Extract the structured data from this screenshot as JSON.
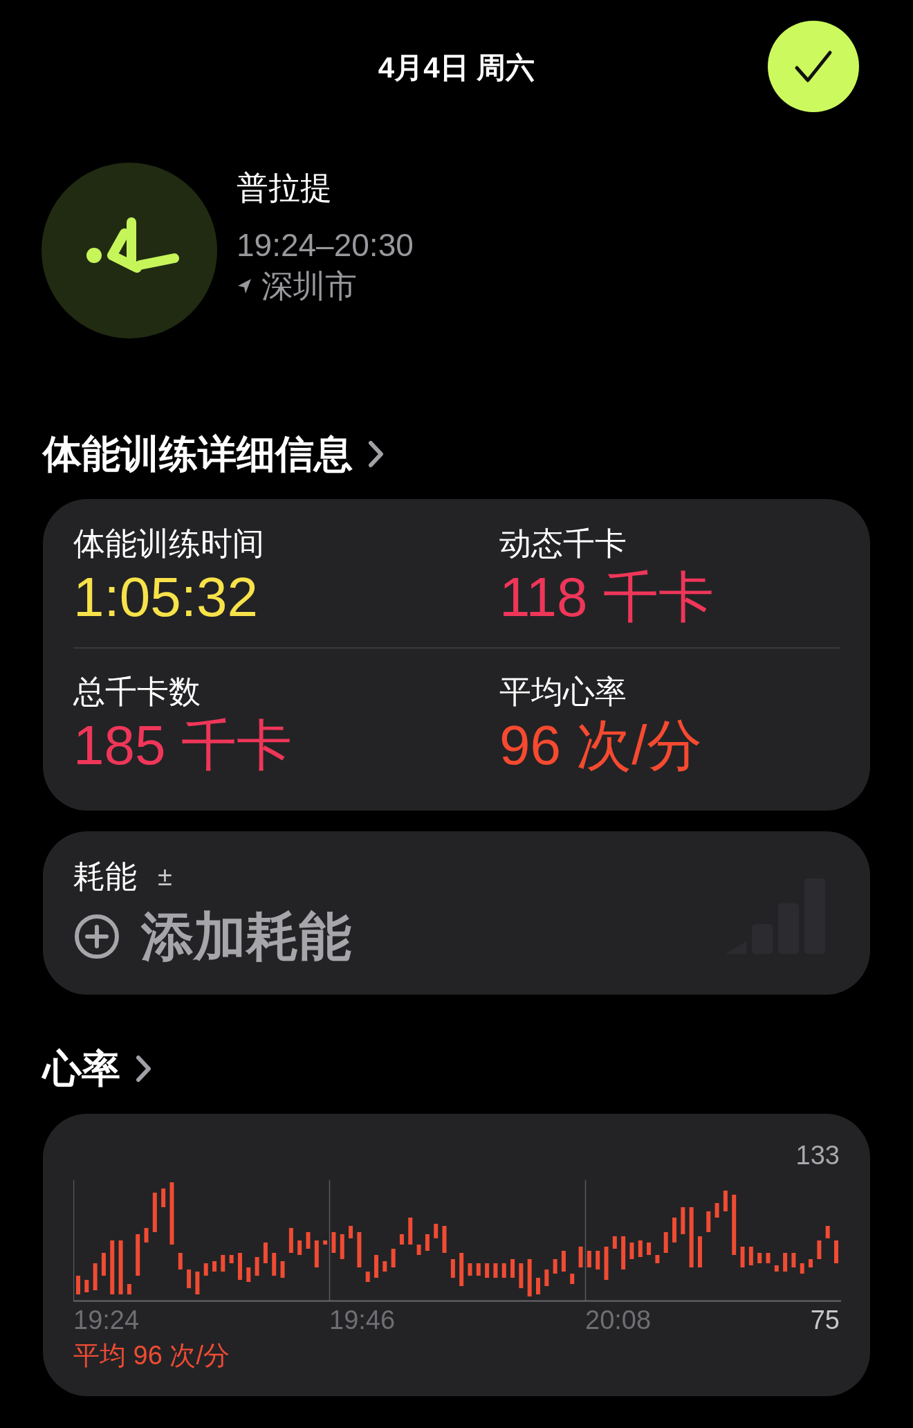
{
  "header": {
    "date": "4月4日 周六"
  },
  "workout": {
    "name": "普拉提",
    "time": "19:24–20:30",
    "location": "深圳市"
  },
  "details": {
    "heading": "体能训练详细信息",
    "metrics": [
      {
        "label": "体能训练时间",
        "value": "1:05:32",
        "color": "#f7e24a"
      },
      {
        "label": "动态千卡",
        "value": "118 千卡",
        "color": "#ef3659"
      },
      {
        "label": "总千卡数",
        "value": "185 千卡",
        "color": "#ef3659"
      },
      {
        "label": "平均心率",
        "value": "96 次/分",
        "color": "#f64a30"
      }
    ]
  },
  "effort": {
    "label": "耗能",
    "sign": "±",
    "action": "添加耗能"
  },
  "heart_rate": {
    "heading": "心率",
    "y_max": "133",
    "y_min": "75",
    "x_labels": [
      "19:24",
      "19:46",
      "20:08"
    ],
    "average": "平均 96 次/分"
  }
}
